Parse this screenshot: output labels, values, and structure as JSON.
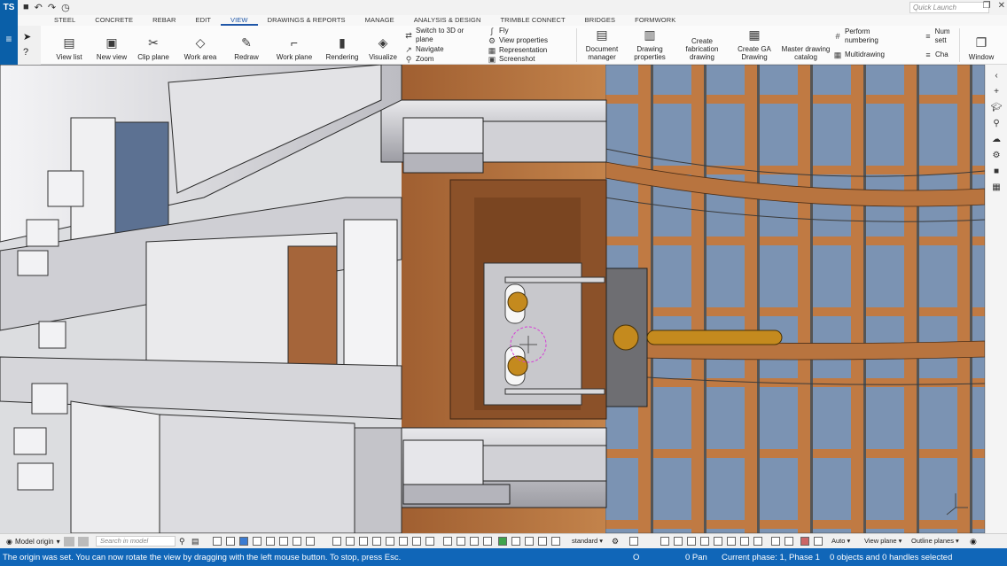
{
  "app": {
    "logo_text": "TS",
    "quick_launch_placeholder": "Quick Launch"
  },
  "tabs": [
    "STEEL",
    "CONCRETE",
    "REBAR",
    "EDIT",
    "VIEW",
    "DRAWINGS & REPORTS",
    "MANAGE",
    "ANALYSIS & DESIGN",
    "TRIMBLE CONNECT",
    "BRIDGES",
    "FORMWORK"
  ],
  "active_tab": "VIEW",
  "ribbon": {
    "view_list": "View list",
    "new_view": "New view",
    "clip_plane": "Clip plane",
    "work_area": "Work area",
    "redraw": "Redraw",
    "work_plane": "Work plane",
    "rendering": "Rendering",
    "visualize": "Visualize",
    "switch_3d": "Switch to 3D or plane",
    "navigate": "Navigate",
    "zoom": "Zoom",
    "fly": "Fly",
    "view_properties": "View properties",
    "representation": "Representation",
    "screenshot": "Screenshot",
    "document_manager": "Document manager",
    "drawing_properties": "Drawing properties",
    "create_fabrication_drawing": "Create fabrication drawing",
    "create_ga_drawing": "Create GA Drawing",
    "master_drawing_catalog": "Master drawing catalog",
    "perform_numbering": "Perform numbering",
    "multidrawing": "Multidrawing",
    "num_settings": "Num sett",
    "cha": "Cha",
    "window": "Window"
  },
  "bottombar": {
    "model_origin": "Model origin",
    "search_placeholder": "Search in model",
    "standard": "standard",
    "auto": "Auto",
    "view_plane": "View plane",
    "outline_planes": "Outline planes"
  },
  "statusbar": {
    "message": "The origin was set. You can now rotate the view by dragging with the left mouse button. To stop, press Esc.",
    "o": "O",
    "pan": "0 Pan",
    "phase": "Current phase: 1, Phase 1",
    "selection": "0 objects and 0 handles selected"
  },
  "colors": {
    "accent": "#1066b8",
    "brand": "#0a5fa8",
    "steel": "#d9d9dc",
    "wood": "#b0703e",
    "glass": "#7f99b8",
    "bolt": "#c48a1e"
  },
  "icons": [
    "select-arrow-icon",
    "view-list-icon",
    "new-view-icon",
    "scissors-icon",
    "work-area-icon",
    "redraw-icon",
    "work-plane-icon",
    "rendering-icon",
    "visualize-icon",
    "gear-icon",
    "search-icon"
  ]
}
